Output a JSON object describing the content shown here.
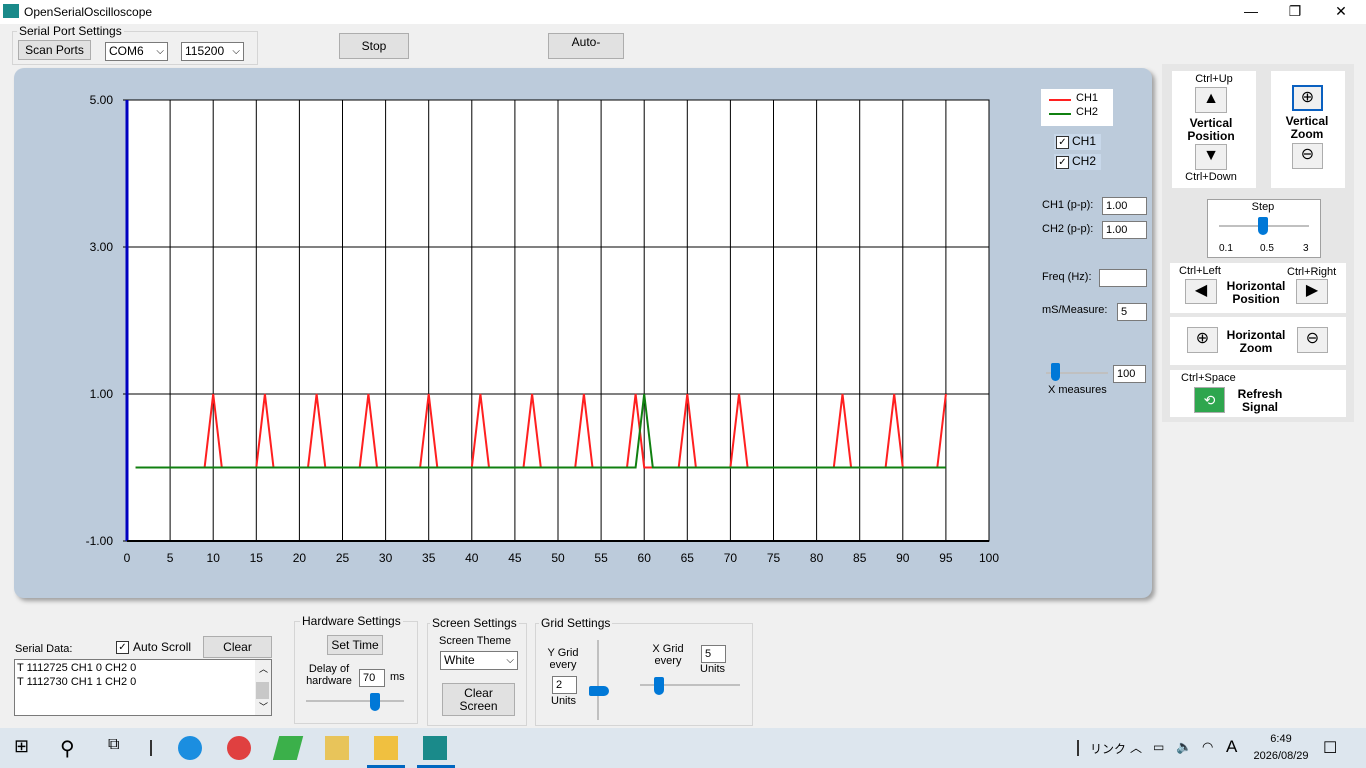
{
  "window": {
    "title": "OpenSerialOscilloscope",
    "min": "—",
    "max": "❐",
    "close": "✕"
  },
  "serial_port": {
    "group_label": "Serial Port Settings",
    "scan_label": "Scan Ports",
    "port": "COM6",
    "baud": "115200"
  },
  "toolbar": {
    "stop_label": "Stop",
    "auto_label": "Auto-"
  },
  "legend": {
    "ch1": "CH1",
    "ch2": "CH2"
  },
  "channels": {
    "ch1_label": "CH1",
    "ch2_label": "CH2"
  },
  "measure": {
    "ch1_pp_label": "CH1 (p-p):",
    "ch1_pp": "1.00",
    "ch2_pp_label": "CH2 (p-p):",
    "ch2_pp": "1.00",
    "freq_label": "Freq (Hz):",
    "freq": "",
    "ms_label": "mS/Measure:",
    "ms": "5",
    "xmeasures_label": "X measures",
    "xmeasures": "100"
  },
  "vertical": {
    "up_hint": "Ctrl+Up",
    "down_hint": "Ctrl+Down",
    "pos_label1": "Vertical",
    "pos_label2": "Position",
    "zoom_label1": "Vertical",
    "zoom_label2": "Zoom"
  },
  "step": {
    "label": "Step",
    "min": "0.1",
    "mid": "0.5",
    "max": "3"
  },
  "horizontal": {
    "left_hint": "Ctrl+Left",
    "right_hint": "Ctrl+Right",
    "pos_label1": "Horizontal",
    "pos_label2": "Position",
    "zoom_label1": "Horizontal",
    "zoom_label2": "Zoom"
  },
  "refresh": {
    "hint": "Ctrl+Space",
    "label1": "Refresh",
    "label2": "Signal"
  },
  "serial_data": {
    "label": "Serial Data:",
    "auto_scroll": "Auto Scroll",
    "clear": "Clear",
    "lines": [
      "T 1112725 CH1 0 CH2 0",
      "T 1112730 CH1 1 CH2 0"
    ]
  },
  "hardware": {
    "group_label": "Hardware Settings",
    "set_time": "Set Time",
    "delay_label1": "Delay of",
    "delay_label2": "hardware",
    "delay": "70",
    "unit": "ms"
  },
  "screen": {
    "group_label": "Screen Settings",
    "theme_label": "Screen Theme",
    "theme": "White",
    "clear_label1": "Clear",
    "clear_label2": "Screen"
  },
  "grid": {
    "group_label": "Grid Settings",
    "y_label1": "Y  Grid",
    "y_label2": "every",
    "y_value": "2",
    "y_units": "Units",
    "x_label1": "X  Grid",
    "x_label2": "every",
    "x_value": "5",
    "x_units": "Units"
  },
  "taskbar": {
    "link": "リンク",
    "ime": "A",
    "time": "6:49",
    "date": "2026/08/29"
  },
  "colors": {
    "ch1": "#ff2020",
    "ch2": "#108010",
    "plot_bg": "#bccbdb",
    "axis": "#0000c0"
  },
  "chart_data": {
    "type": "line",
    "xlim": [
      0,
      100
    ],
    "ylim": [
      -1,
      5
    ],
    "x_ticks": [
      "0",
      "5",
      "10",
      "15",
      "20",
      "25",
      "30",
      "35",
      "40",
      "45",
      "50",
      "55",
      "60",
      "65",
      "70",
      "75",
      "80",
      "85",
      "90",
      "95",
      "100"
    ],
    "y_ticks": [
      "5.00",
      "3.00",
      "1.00",
      "-1.00"
    ],
    "y_tick_values": [
      5,
      3,
      1,
      -1
    ],
    "grid": true,
    "legend_placement": "top-right",
    "series": [
      {
        "name": "CH1",
        "color": "#ff2020",
        "x": [
          1,
          9,
          10,
          11,
          15,
          16,
          17,
          21,
          22,
          23,
          27,
          28,
          29,
          34,
          35,
          36,
          40,
          41,
          42,
          46,
          47,
          48,
          52,
          53,
          54,
          58,
          59,
          60,
          64,
          65,
          66,
          70,
          71,
          72,
          82,
          83,
          84,
          88,
          89,
          90,
          94,
          95
        ],
        "y": [
          0,
          0,
          1,
          0,
          0,
          1,
          0,
          0,
          1,
          0,
          0,
          1,
          0,
          0,
          1,
          0,
          0,
          1,
          0,
          0,
          1,
          0,
          0,
          1,
          0,
          0,
          1,
          0,
          0,
          1,
          0,
          0,
          1,
          0,
          0,
          1,
          0,
          0,
          1,
          0,
          0,
          1
        ]
      },
      {
        "name": "CH2",
        "color": "#108010",
        "x": [
          1,
          59,
          60,
          61,
          95
        ],
        "y": [
          0,
          0,
          1,
          0,
          0
        ]
      }
    ]
  }
}
